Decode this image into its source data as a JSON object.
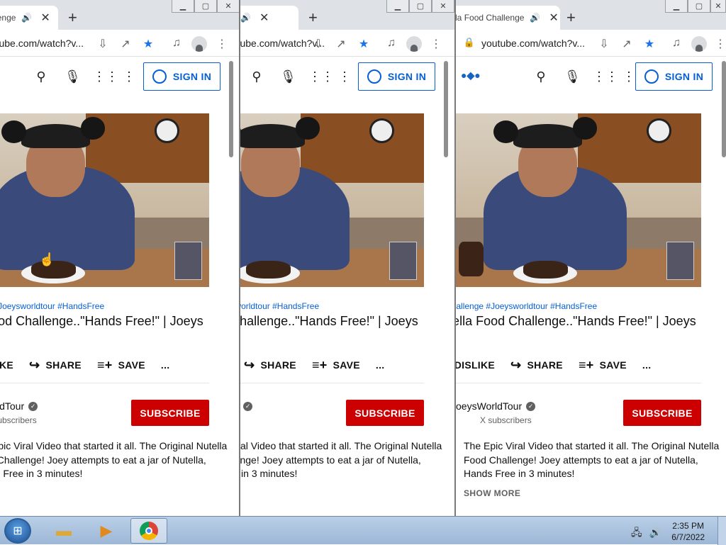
{
  "windows": [
    {
      "tab": {
        "title": "Nutella Food Challenge",
        "speaker": "🔊",
        "close": "✕"
      },
      "new_tab": "+",
      "url": "youtube.com/watch?v...",
      "header": {
        "sign_in": "SIGN IN"
      },
      "tags": "#NutellaChallenge #Joeysworldtour #HandsFree",
      "title": "The Original Nutella Food Challenge..\"Hands Free!\" | Joeys",
      "actions": {
        "dislike": "DISLIKE",
        "share": "SHARE",
        "save": "SAVE",
        "more": "..."
      },
      "channel": {
        "name": "JoeysWorldTour",
        "subscribers": "X subscribers",
        "subscribe": "SUBSCRIBE"
      },
      "description": [
        "The Epic Viral Video that started it all. The Original Nutella",
        "Food Challenge!  Joey attempts to eat a jar of Nutella,",
        "Hands Free in 3 minutes!"
      ],
      "show_more": "SHOW MORE"
    }
  ],
  "taskbar": {
    "start_label": "Start",
    "time": "2:35 PM",
    "date": "6/7/2022"
  }
}
